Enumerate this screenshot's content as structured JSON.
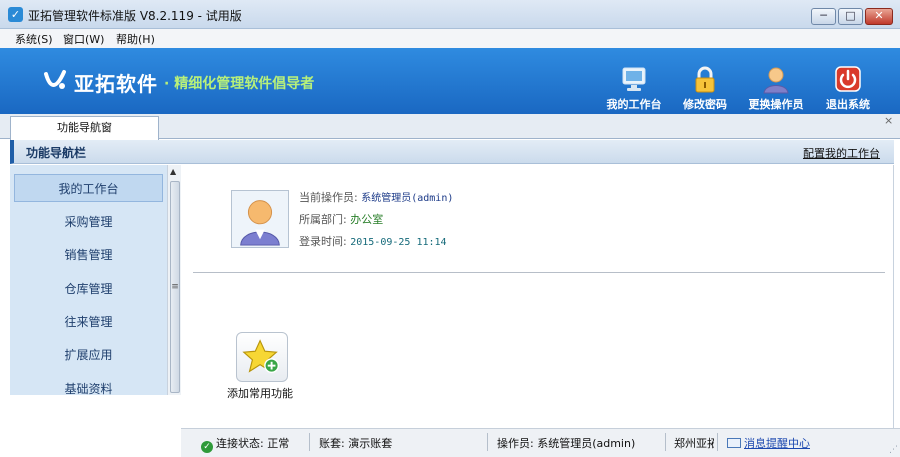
{
  "window": {
    "title": "亚拓管理软件标准版 V8.2.119 - 试用版",
    "min_glyph": "─",
    "max_glyph": "□",
    "close_glyph": "✕"
  },
  "menu": {
    "items": [
      "系统(S)",
      "窗口(W)",
      "帮助(H)"
    ]
  },
  "banner": {
    "logo_text": "亚拓软件",
    "slogan": "· 精细化管理软件倡导者",
    "tools": [
      {
        "label": "我的工作台",
        "icon": "monitor-icon"
      },
      {
        "label": "修改密码",
        "icon": "lock-icon"
      },
      {
        "label": "更换操作员",
        "icon": "user-icon"
      },
      {
        "label": "退出系统",
        "icon": "power-icon"
      }
    ],
    "colors": {
      "background": "#1f78d2",
      "slogan": "#b8f07a"
    }
  },
  "tabs": {
    "active": "功能导航窗",
    "close_glyph": "×"
  },
  "nav": {
    "title": "功能导航栏",
    "configure_link": "配置我的工作台",
    "items": [
      "我的工作台",
      "采购管理",
      "销售管理",
      "仓库管理",
      "往来管理",
      "扩展应用",
      "基础资料"
    ],
    "active_index": 0
  },
  "user": {
    "operator_label": "当前操作员:",
    "operator_value": "系统管理员(admin)",
    "dept_label": "所属部门:",
    "dept_value": "办公室",
    "login_label": "登录时间:",
    "login_value": "2015-09-25 11:14",
    "avatar_icon": "user-avatar-icon"
  },
  "quick": {
    "add_label": "添加常用功能",
    "icon": "star-add-icon"
  },
  "status": {
    "connection": "连接状态: 正常",
    "account": "账套: 演示账套",
    "operator": "操作员: 系统管理员(admin)",
    "company": "郑州亚拓",
    "reminder": "消息提醒中心"
  }
}
